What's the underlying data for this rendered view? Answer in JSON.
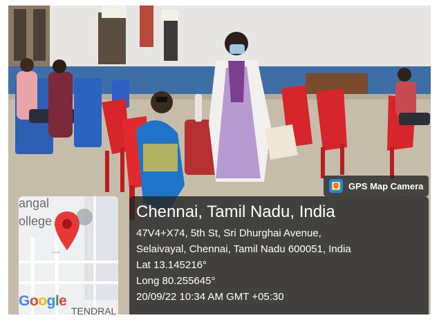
{
  "app": {
    "name": "GPS Map Camera",
    "icon": "gps-map-camera-icon",
    "accent": "#1e88e5"
  },
  "location": {
    "title": "Chennai, Tamil Nadu, India",
    "address_line1": "47V4+X74, 5th St, Sri Dhurghai Avenue,",
    "address_line2": "Selaivayal, Chennai, Tamil Nadu 600051, India",
    "latitude": "Lat 13.145216°",
    "longitude": "Long 80.255645°",
    "datetime": "20/09/22 10:34 AM GMT +05:30"
  },
  "map": {
    "label_top1": "angal",
    "label_top2": "ollege",
    "brand": [
      "G",
      "o",
      "o",
      "g",
      "l",
      "e"
    ],
    "area_label": "TENDRAL",
    "pin_color": "#e53935"
  },
  "photo": {
    "description_icons": [
      "chair-icon",
      "person-icon"
    ]
  }
}
